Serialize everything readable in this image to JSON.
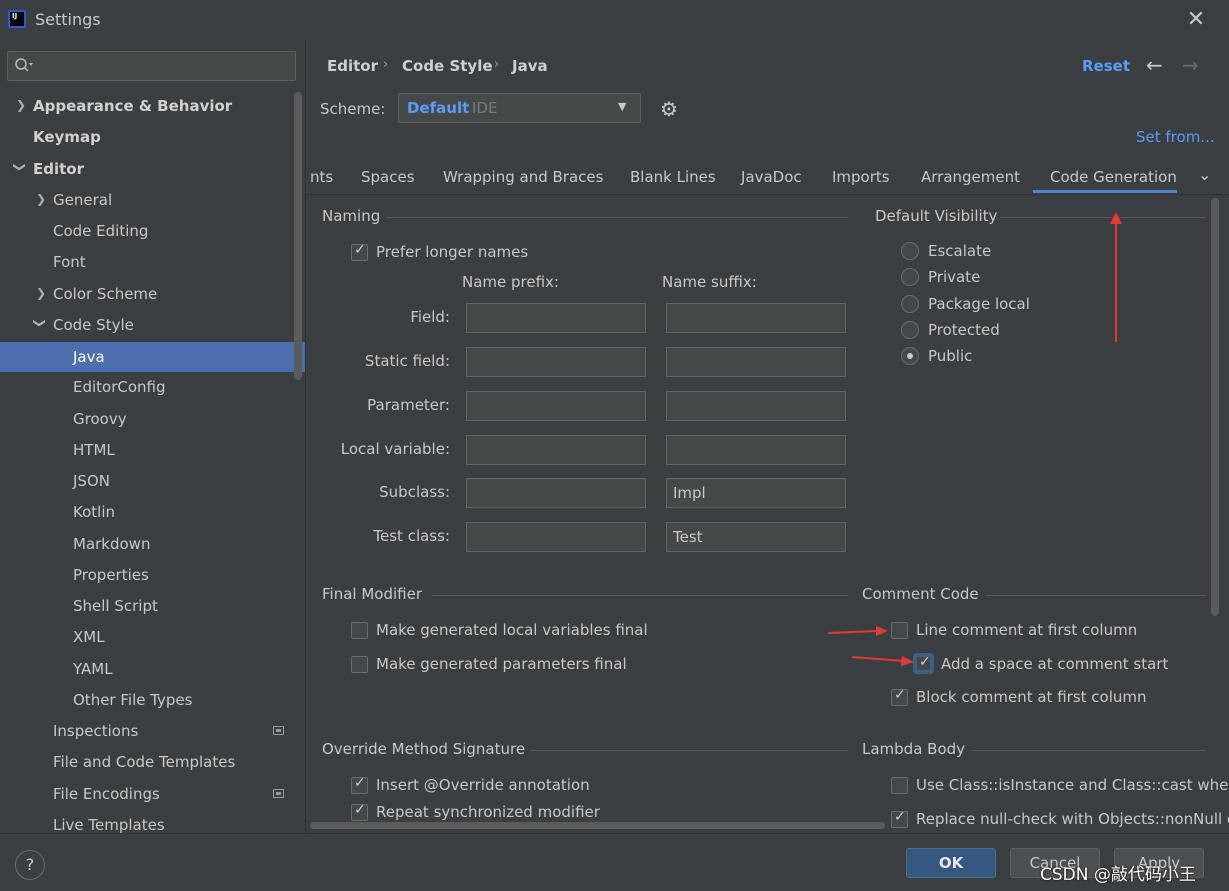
{
  "window": {
    "title": "Settings",
    "logo_text": "IJ"
  },
  "search": {
    "placeholder": ""
  },
  "sidebar": {
    "items": [
      {
        "label": "Appearance & Behavior"
      },
      {
        "label": "Keymap"
      },
      {
        "label": "Editor"
      },
      {
        "label": "General"
      },
      {
        "label": "Code Editing"
      },
      {
        "label": "Font"
      },
      {
        "label": "Color Scheme"
      },
      {
        "label": "Code Style"
      },
      {
        "label": "Java"
      },
      {
        "label": "EditorConfig"
      },
      {
        "label": "Groovy"
      },
      {
        "label": "HTML"
      },
      {
        "label": "JSON"
      },
      {
        "label": "Kotlin"
      },
      {
        "label": "Markdown"
      },
      {
        "label": "Properties"
      },
      {
        "label": "Shell Script"
      },
      {
        "label": "XML"
      },
      {
        "label": "YAML"
      },
      {
        "label": "Other File Types"
      },
      {
        "label": "Inspections"
      },
      {
        "label": "File and Code Templates"
      },
      {
        "label": "File Encodings"
      },
      {
        "label": "Live Templates"
      }
    ]
  },
  "header": {
    "breadcrumb": [
      "Editor",
      "Code Style",
      "Java"
    ],
    "reset": "Reset",
    "scheme_label": "Scheme:",
    "scheme_value": "Default",
    "scheme_sub": "IDE",
    "set_from": "Set from..."
  },
  "tabs": [
    {
      "label": "nts"
    },
    {
      "label": "Spaces"
    },
    {
      "label": "Wrapping and Braces"
    },
    {
      "label": "Blank Lines"
    },
    {
      "label": "JavaDoc"
    },
    {
      "label": "Imports"
    },
    {
      "label": "Arrangement"
    },
    {
      "label": "Code Generation"
    }
  ],
  "naming": {
    "title": "Naming",
    "prefer_longer": "Prefer longer names",
    "prefix_header": "Name prefix:",
    "suffix_header": "Name suffix:",
    "rows": [
      {
        "label": "Field:",
        "prefix": "",
        "suffix": ""
      },
      {
        "label": "Static field:",
        "prefix": "",
        "suffix": ""
      },
      {
        "label": "Parameter:",
        "prefix": "",
        "suffix": ""
      },
      {
        "label": "Local variable:",
        "prefix": "",
        "suffix": ""
      },
      {
        "label": "Subclass:",
        "prefix": "",
        "suffix": "Impl"
      },
      {
        "label": "Test class:",
        "prefix": "",
        "suffix": "Test"
      }
    ]
  },
  "visibility": {
    "title": "Default Visibility",
    "options": [
      "Escalate",
      "Private",
      "Package local",
      "Protected",
      "Public"
    ],
    "selected": "Public"
  },
  "final_modifier": {
    "title": "Final Modifier",
    "local_vars": "Make generated local variables final",
    "params": "Make generated parameters final"
  },
  "comment_code": {
    "title": "Comment Code",
    "line_first": "Line comment at first column",
    "add_space": "Add a space at comment start",
    "block_first": "Block comment at first column"
  },
  "override": {
    "title": "Override Method Signature",
    "insert_override": "Insert @Override annotation",
    "repeat_sync": "Repeat synchronized modifier"
  },
  "lambda": {
    "title": "Lambda Body",
    "use_class": "Use Class::isInstance and Class::cast when p",
    "replace_null": "Replace null-check with Objects::nonNull o"
  },
  "footer": {
    "help": "?",
    "ok": "OK",
    "cancel": "Cancel",
    "apply": "Apply",
    "watermark": "CSDN @敲代码小王"
  },
  "colors": {
    "accent": "#589df6",
    "selection": "#4b6eaf",
    "annotation": "#e53935"
  }
}
